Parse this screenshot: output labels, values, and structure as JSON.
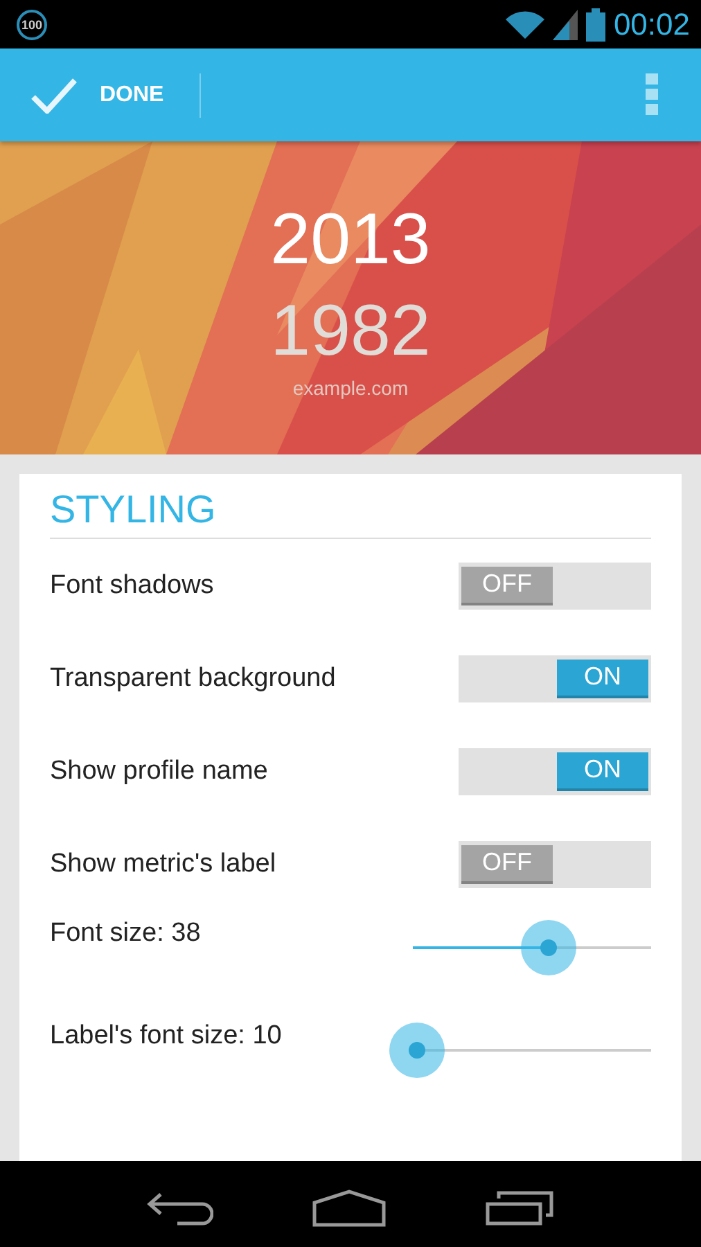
{
  "status_bar": {
    "badge": "100",
    "time": "00:02"
  },
  "action_bar": {
    "done_label": "DONE"
  },
  "header": {
    "kind": "picture",
    "primary": "2013",
    "secondary": "1982",
    "site": "example.com"
  },
  "section": {
    "title": "STYLING"
  },
  "settings": [
    {
      "kind": "toggle",
      "label": "Font shadows",
      "on": false,
      "text": "OFF"
    },
    {
      "kind": "toggle",
      "label": "Transparent background",
      "on": true,
      "text": "ON"
    },
    {
      "kind": "toggle",
      "label": "Show profile name",
      "on": true,
      "text": "ON"
    },
    {
      "kind": "toggle",
      "label": "Show metric's label",
      "on": false,
      "text": "OFF"
    },
    {
      "kind": "slider",
      "label": "Font size: 38",
      "level": 0.57
    },
    {
      "kind": "slider",
      "label": "Label's font size: 10",
      "level": 0.02
    }
  ]
}
